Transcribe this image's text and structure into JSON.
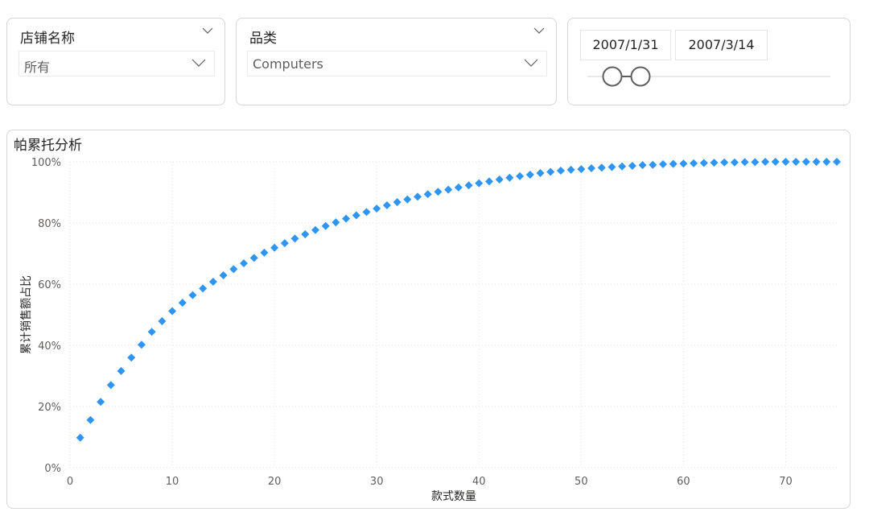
{
  "store_slicer": {
    "title": "店铺名称",
    "selected": "所有"
  },
  "category_slicer": {
    "title": "品类",
    "selected": "Computers"
  },
  "date_slicer": {
    "start": "2007/1/31",
    "end": "2007/3/14"
  },
  "colors": {
    "accent": "#2f95f2",
    "grid": "#e3e3e3",
    "axis_text": "#605e5c"
  },
  "chart_data": {
    "type": "scatter",
    "title": "帕累托分析",
    "xlabel": "款式数量",
    "ylabel": "累计销售额占比",
    "xlim": [
      0,
      75
    ],
    "ylim": [
      0,
      100
    ],
    "x_ticks": [
      "0",
      "10",
      "20",
      "30",
      "40",
      "50",
      "60",
      "70"
    ],
    "y_ticks": [
      "0%",
      "20%",
      "40%",
      "60%",
      "80%",
      "100%"
    ],
    "grid": true,
    "marker": "diamond",
    "series": [
      {
        "x": [
          1,
          2,
          3,
          4,
          5,
          6,
          7,
          8,
          9,
          10,
          11,
          12,
          13,
          14,
          15,
          16,
          17,
          18,
          19,
          20,
          21,
          22,
          23,
          24,
          25,
          26,
          27,
          28,
          29,
          30,
          31,
          32,
          33,
          34,
          35,
          36,
          37,
          38,
          39,
          40,
          41,
          42,
          43,
          44,
          45,
          46,
          47,
          48,
          49,
          50,
          51,
          52,
          53,
          54,
          55,
          56,
          57,
          58,
          59,
          60,
          61,
          62,
          63,
          64,
          65,
          66,
          67,
          68,
          69,
          70,
          71,
          72,
          73,
          74,
          75
        ],
        "y": [
          9.8,
          15.6,
          21.5,
          27.0,
          31.6,
          36.0,
          40.2,
          44.4,
          47.9,
          51.2,
          53.9,
          56.4,
          58.6,
          60.8,
          62.9,
          64.9,
          66.8,
          68.6,
          70.3,
          71.9,
          73.4,
          74.9,
          76.3,
          77.7,
          79.0,
          80.2,
          81.4,
          82.5,
          83.6,
          84.7,
          85.8,
          86.8,
          87.7,
          88.6,
          89.4,
          90.2,
          90.9,
          91.6,
          92.3,
          93.0,
          93.6,
          94.2,
          94.8,
          95.3,
          95.8,
          96.3,
          96.7,
          97.1,
          97.4,
          97.6,
          97.9,
          98.1,
          98.3,
          98.5,
          98.7,
          98.9,
          99.0,
          99.2,
          99.3,
          99.4,
          99.5,
          99.6,
          99.7,
          99.8,
          99.8,
          99.9,
          99.9,
          100,
          100,
          100,
          100,
          100,
          100,
          100,
          100
        ]
      }
    ]
  }
}
